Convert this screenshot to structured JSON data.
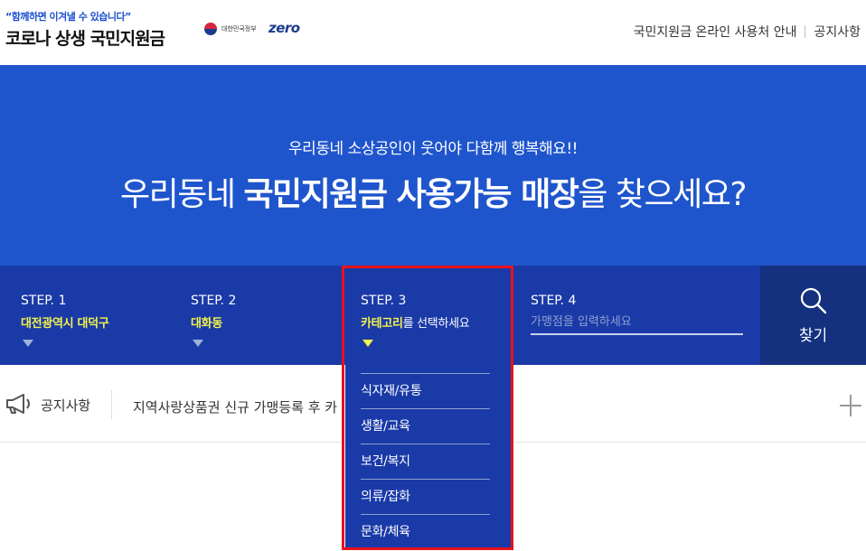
{
  "header": {
    "slogan": "“함께하면 이겨낼 수 있습니다”",
    "title": "코로나 상생 국민지원금",
    "gov_label": "대한민국정부",
    "zero_logo": "zero",
    "nav": [
      "국민지원금 온라인 사용처 안내",
      "공지사항"
    ]
  },
  "hero": {
    "subtitle": "우리동네 소상공인이 웃어야 다함께 행복해요!!",
    "main_prefix": "우리동네 ",
    "main_bold": "국민지원금 사용가능 매장",
    "main_suffix": "을 찾으세요?",
    "bg_color": "#1f55cc"
  },
  "steps": [
    {
      "label": "STEP. 1",
      "value": "대전광역시 대덕구"
    },
    {
      "label": "STEP. 2",
      "value": "대화동"
    },
    {
      "label": "STEP. 3",
      "value_highlight": "카테고리",
      "value_rest": "를 선택하세요"
    },
    {
      "label": "STEP. 4",
      "placeholder": "가맹점을 입력하세요"
    }
  ],
  "search": {
    "label": "찾기",
    "icon": "search-icon"
  },
  "category_options": [
    "식자재/유통",
    "생활/교육",
    "보건/복지",
    "의류/잡화",
    "문화/체육"
  ],
  "notice": {
    "label": "공지사항",
    "text": "지역사랑상품권 신규 가맹등록 후 카",
    "icon": "megaphone-icon"
  },
  "colors": {
    "accent_yellow": "#f3f14a",
    "steps_bg": "#1a3aa8",
    "highlight_red": "#e8111b"
  }
}
